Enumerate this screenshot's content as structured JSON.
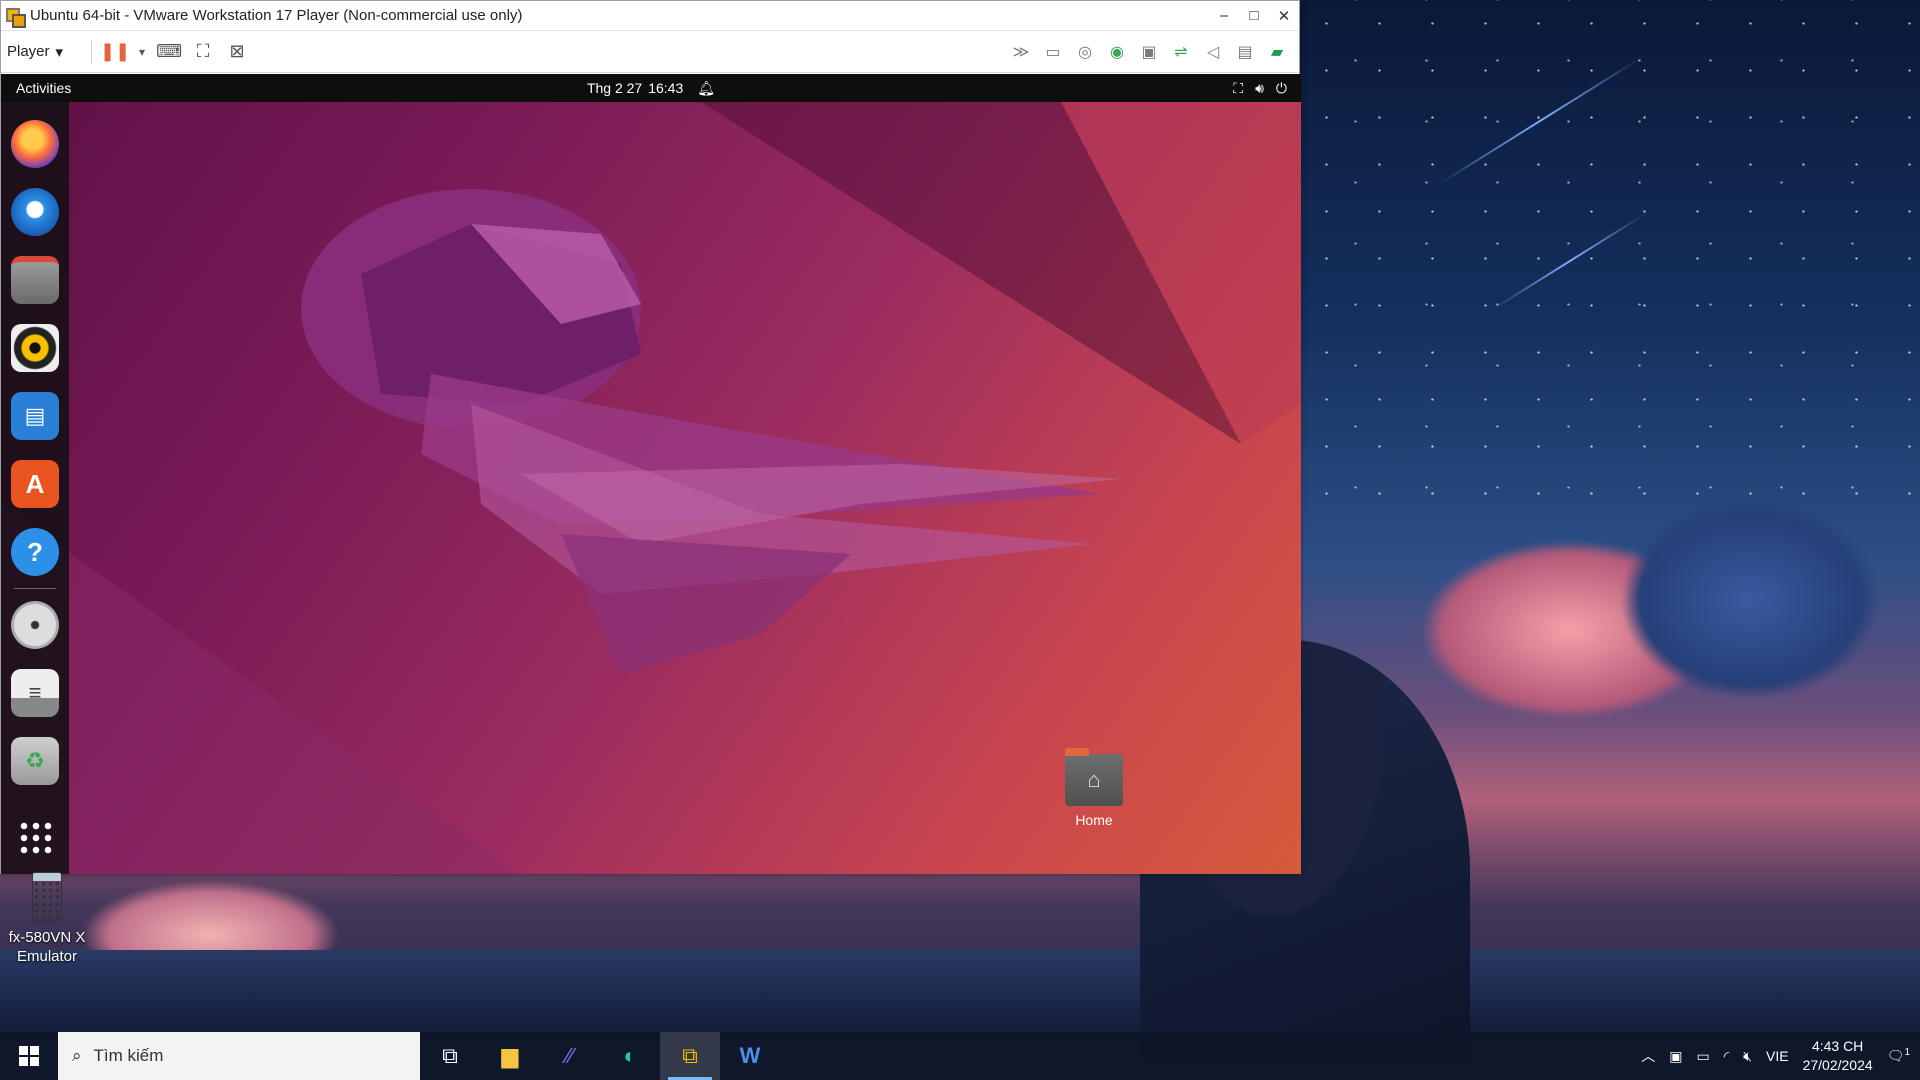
{
  "window": {
    "title": "Ubuntu 64-bit - VMware Workstation 17 Player (Non-commercial use only)",
    "controls": {
      "minimize": "–",
      "maximize": "□",
      "close": "✕"
    }
  },
  "toolbar": {
    "player_label": "Player",
    "icons": [
      "pause-icon",
      "send-ctrl-alt-del-icon",
      "full-screen-icon",
      "unity-icon"
    ],
    "right_icons": [
      "more-icon",
      "hard-disk-icon",
      "cd-icon",
      "network-icon",
      "floppy-icon",
      "usb-icon",
      "sound-icon",
      "printer-icon",
      "message-log-icon"
    ]
  },
  "ubuntu": {
    "activities": "Activities",
    "date": "Thg 2 27",
    "time": "16:43",
    "dock": [
      "firefox",
      "thunderbird",
      "files",
      "rhythmbox",
      "libreoffice-writer",
      "app-center",
      "help",
      "dvd",
      "text-editor",
      "trash"
    ],
    "home_label": "Home"
  },
  "desktop": {
    "icon_label_line1": "fx-580VN X",
    "icon_label_line2": "Emulator"
  },
  "taskbar": {
    "search_placeholder": "Tìm kiếm",
    "apps": [
      "task-view",
      "file-explorer",
      "visual-studio",
      "edge",
      "vmware",
      "word"
    ],
    "language": "VIE",
    "time": "4:43 CH",
    "date": "27/02/2024",
    "notification_count": "1"
  }
}
